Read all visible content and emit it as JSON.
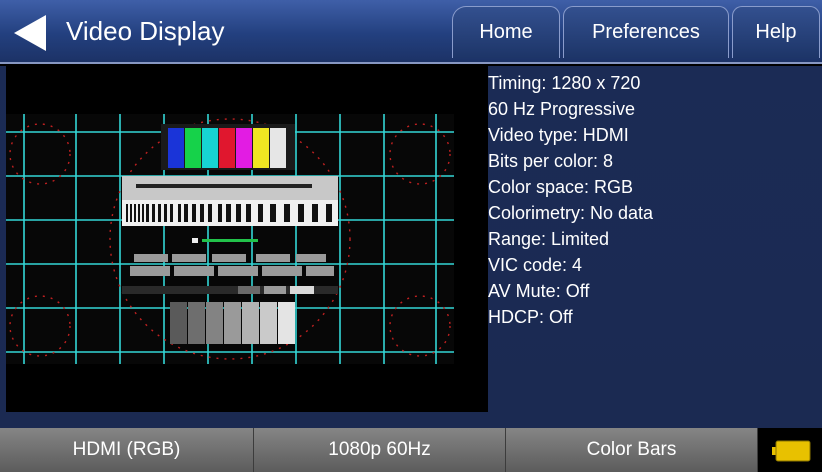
{
  "header": {
    "title": "Video Display",
    "tabs": {
      "home": "Home",
      "preferences": "Preferences",
      "help": "Help"
    }
  },
  "status_lines": [
    "Timing: 1280 x 720",
    "60 Hz Progressive",
    "Video type: HDMI",
    "Bits per color: 8",
    "Color space: RGB",
    "Colorimetry: No data",
    "Range: Limited",
    "VIC code: 4",
    "AV Mute: Off",
    "HDCP: Off"
  ],
  "footer": {
    "interface": "HDMI (RGB)",
    "format": "1080p 60Hz",
    "image": "Color Bars"
  },
  "colors": {
    "header_blue": "#23407f",
    "grid_cyan": "#33d6d6",
    "battery_yellow": "#e8c100",
    "bars": [
      "#1a34d8",
      "#16d24a",
      "#17d3d3",
      "#e0172e",
      "#e21ce3",
      "#f0e622",
      "#e6e6e6"
    ]
  }
}
